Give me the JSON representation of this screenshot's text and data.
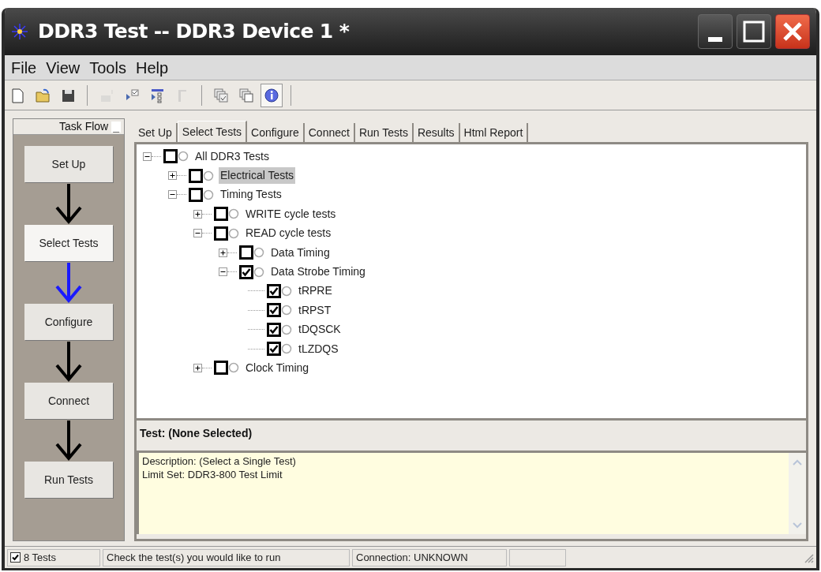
{
  "window": {
    "title": "DDR3 Test -- DDR3 Device 1 *"
  },
  "menu": [
    "File",
    "View",
    "Tools",
    "Help"
  ],
  "toolbar": [
    {
      "kind": "new",
      "disabled": false,
      "pressed": false
    },
    {
      "kind": "open",
      "disabled": false,
      "pressed": false
    },
    {
      "kind": "save",
      "disabled": false,
      "pressed": false
    },
    {
      "kind": "separator"
    },
    {
      "kind": "chart",
      "disabled": true,
      "pressed": false
    },
    {
      "kind": "run-checked",
      "disabled": false,
      "pressed": false
    },
    {
      "kind": "run-list",
      "disabled": false,
      "pressed": false
    },
    {
      "kind": "stop",
      "disabled": true,
      "pressed": false
    },
    {
      "kind": "separator"
    },
    {
      "kind": "layers-check",
      "disabled": false,
      "pressed": false
    },
    {
      "kind": "layers",
      "disabled": false,
      "pressed": false
    },
    {
      "kind": "info",
      "disabled": false,
      "pressed": true
    },
    {
      "kind": "separator"
    }
  ],
  "task_flow": {
    "title": "Task Flow",
    "minimize": "_",
    "steps": [
      {
        "label": "Set Up",
        "selected": false
      },
      {
        "label": "Select Tests",
        "selected": true
      },
      {
        "label": "Configure",
        "selected": false
      },
      {
        "label": "Connect",
        "selected": false
      },
      {
        "label": "Run Tests",
        "selected": false
      }
    ]
  },
  "tabs": [
    {
      "label": "Set Up",
      "selected": false
    },
    {
      "label": "Select Tests",
      "selected": true
    },
    {
      "label": "Configure",
      "selected": false
    },
    {
      "label": "Connect",
      "selected": false
    },
    {
      "label": "Run Tests",
      "selected": false
    },
    {
      "label": "Results",
      "selected": false
    },
    {
      "label": "Html Report",
      "selected": false
    }
  ],
  "tree": [
    {
      "label": "All DDR3 Tests",
      "checked": false,
      "selected": false,
      "expanded": true,
      "children": [
        {
          "label": "Electrical Tests",
          "checked": false,
          "selected": true,
          "expanded": false
        },
        {
          "label": "Timing Tests",
          "checked": false,
          "selected": false,
          "expanded": true,
          "children": [
            {
              "label": "WRITE cycle tests",
              "checked": false,
              "selected": false,
              "expanded": false
            },
            {
              "label": "READ cycle tests",
              "checked": false,
              "selected": false,
              "expanded": true,
              "children": [
                {
                  "label": "Data Timing",
                  "checked": false,
                  "selected": false,
                  "expanded": false
                },
                {
                  "label": "Data Strobe Timing",
                  "checked": true,
                  "selected": false,
                  "expanded": true,
                  "children": [
                    {
                      "label": "tRPRE",
                      "checked": true,
                      "selected": false
                    },
                    {
                      "label": "tRPST",
                      "checked": true,
                      "selected": false
                    },
                    {
                      "label": "tDQSCK",
                      "checked": true,
                      "selected": false
                    },
                    {
                      "label": "tLZDQS",
                      "checked": true,
                      "selected": false
                    }
                  ]
                }
              ]
            },
            {
              "label": "Clock Timing",
              "checked": false,
              "selected": false,
              "expanded": false
            }
          ]
        }
      ]
    }
  ],
  "test_info": {
    "heading": "Test: (None Selected)",
    "description": [
      "Description: (Select a Single Test)",
      "Limit Set: DDR3-800 Test Limit"
    ]
  },
  "status_bar": {
    "tests_checked": true,
    "tests": "8 Tests",
    "message": "Check the test(s) you would like to run",
    "connection": "Connection: UNKNOWN"
  }
}
